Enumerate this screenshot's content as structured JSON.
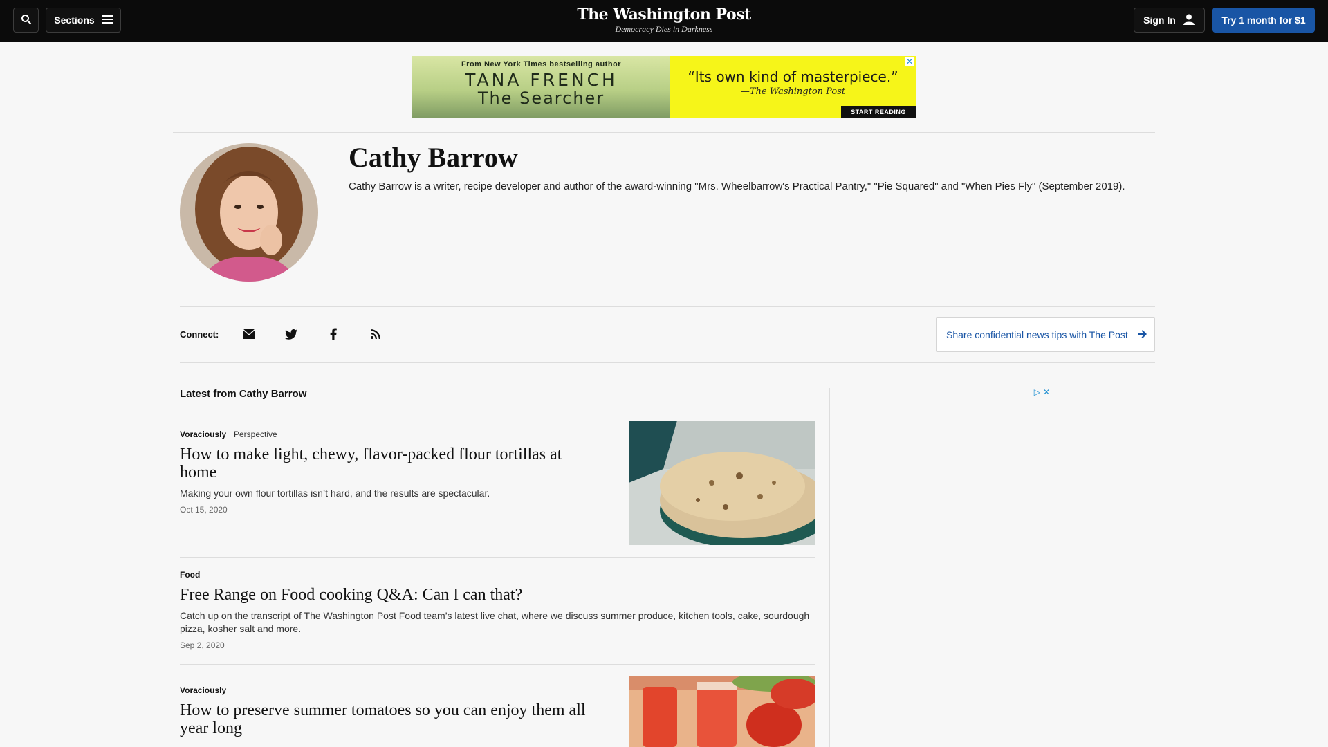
{
  "header": {
    "sections_label": "Sections",
    "logo_title": "The Washington Post",
    "logo_tagline": "Democracy Dies in Darkness",
    "sign_in_label": "Sign In",
    "subscribe_label": "Try 1 month for $1"
  },
  "ad_banner": {
    "from_text": "From New York Times bestselling author",
    "author": "TANA FRENCH",
    "book": "The Searcher",
    "quote": "“Its own kind of masterpiece.”",
    "attribution": "—The Washington Post",
    "cta": "START READING"
  },
  "author": {
    "name": "Cathy Barrow",
    "bio": "Cathy Barrow is a writer, recipe developer and author of the award-winning \"Mrs. Wheelbarrow's Practical Pantry,\" \"Pie Squared\" and \"When Pies Fly\" (September 2019)."
  },
  "connect": {
    "label": "Connect:",
    "icons": [
      "email-icon",
      "twitter-icon",
      "facebook-icon",
      "rss-icon"
    ],
    "tips_label": "Share confidential news tips with The Post"
  },
  "latest": {
    "heading": "Latest from Cathy Barrow",
    "articles": [
      {
        "kicker": "Voraciously",
        "label": "Perspective",
        "headline": "How to make light, chewy, flavor-packed flour tortillas at home",
        "blurb": "Making your own flour tortillas isn’t hard, and the results are spectacular.",
        "date": "Oct 15, 2020"
      },
      {
        "kicker": "Food",
        "headline": "Free Range on Food cooking Q&A: Can I can that?",
        "blurb": "Catch up on the transcript of The Washington Post Food team’s latest live chat, where we discuss summer produce, kitchen tools, cake, sourdough pizza, kosher salt and more.",
        "date": "Sep 2, 2020"
      },
      {
        "kicker": "Voraciously",
        "headline": "How to preserve summer tomatoes so you can enjoy them all year long"
      }
    ]
  },
  "colors": {
    "topbar": "#0b0b0b",
    "subscribe": "#1955a5",
    "link": "#1955a5",
    "ad_yellow": "#f6f519"
  }
}
